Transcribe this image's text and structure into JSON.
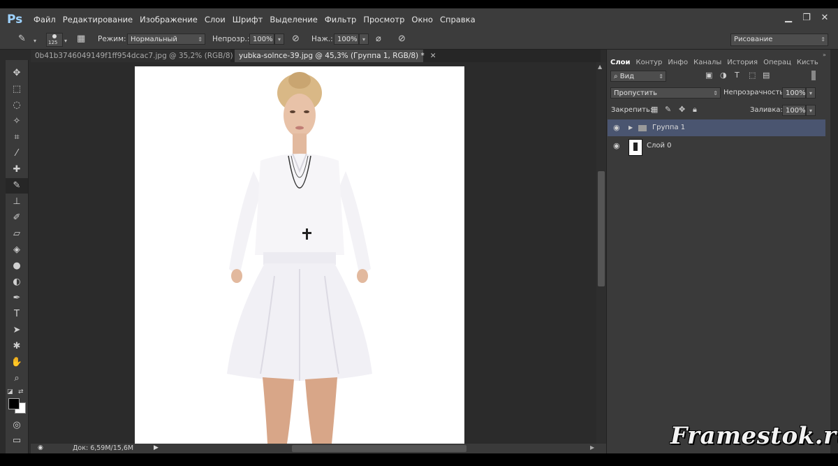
{
  "app": {
    "logo": "Ps",
    "menu": [
      "Файл",
      "Редактирование",
      "Изображение",
      "Слои",
      "Шрифт",
      "Выделение",
      "Фильтр",
      "Просмотр",
      "Окно",
      "Справка"
    ],
    "workspace_preset": "Рисование"
  },
  "options_bar": {
    "brush_size": "125",
    "mode_label": "Режим:",
    "mode_value": "Нормальный",
    "opacity_label": "Непрозр.:",
    "opacity_value": "100%",
    "flow_label": "Наж.:",
    "flow_value": "100%"
  },
  "tabs": [
    {
      "label": "0b41b3746049149f1ff954dcac7.jpg @ 35,2% (RGB/8) *",
      "active": false
    },
    {
      "label": "yubka-solnce-39.jpg @ 45,3% (Группа 1, RGB/8) *",
      "active": true
    }
  ],
  "status": {
    "doc": "Док: 6,59M/15,6M"
  },
  "layers_panel": {
    "tabs": [
      "Слои",
      "Контур",
      "Инфо",
      "Каналы",
      "История",
      "Операц",
      "Кисть"
    ],
    "filter_kind": "Вид",
    "blend_mode": "Пропустить",
    "opacity_label": "Непрозрачность:",
    "opacity_value": "100%",
    "lock_label": "Закрепить:",
    "fill_label": "Заливка:",
    "fill_value": "100%",
    "layers": [
      {
        "name": "Группа 1",
        "type": "group",
        "selected": true
      },
      {
        "name": "Слой 0",
        "type": "layer",
        "selected": false
      }
    ]
  },
  "watermark": "Framestok.ru",
  "colors": {
    "chrome": "#3c3c3c",
    "workspace": "#2b2b2b",
    "selected_layer": "#4a5570",
    "logo": "#9ed3ff"
  }
}
